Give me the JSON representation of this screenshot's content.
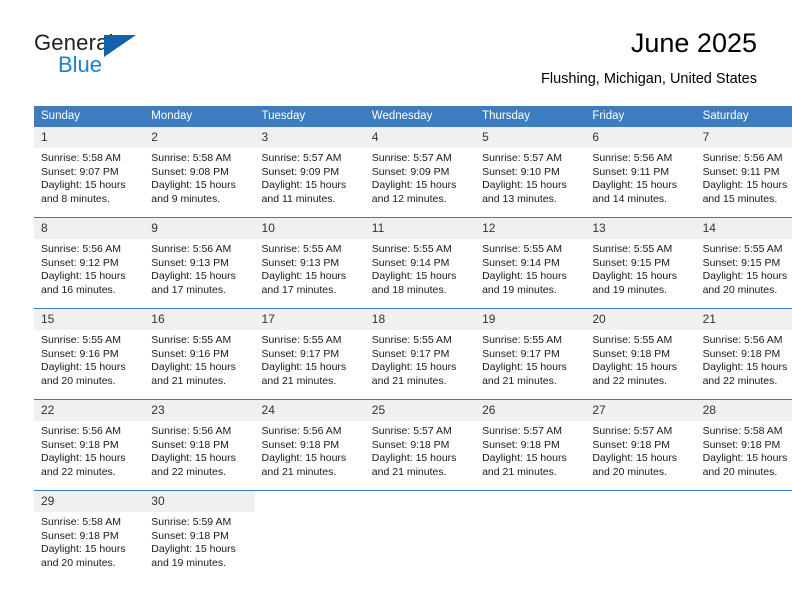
{
  "logo": {
    "word_top": "General",
    "word_bottom": "Blue",
    "triangle_color": "#1161ac",
    "blue_color": "#1b7fd4"
  },
  "header": {
    "title": "June 2025",
    "subtitle": "Flushing, Michigan, United States"
  },
  "theme": {
    "header_blue": "#3b7dbf",
    "daynum_background": "#f0f0f0"
  },
  "calendar": {
    "weekday_headers": [
      "Sunday",
      "Monday",
      "Tuesday",
      "Wednesday",
      "Thursday",
      "Friday",
      "Saturday"
    ],
    "weeks": [
      [
        {
          "day": "1",
          "sunrise": "Sunrise: 5:58 AM",
          "sunset": "Sunset: 9:07 PM",
          "daylight": "Daylight: 15 hours and 8 minutes."
        },
        {
          "day": "2",
          "sunrise": "Sunrise: 5:58 AM",
          "sunset": "Sunset: 9:08 PM",
          "daylight": "Daylight: 15 hours and 9 minutes."
        },
        {
          "day": "3",
          "sunrise": "Sunrise: 5:57 AM",
          "sunset": "Sunset: 9:09 PM",
          "daylight": "Daylight: 15 hours and 11 minutes."
        },
        {
          "day": "4",
          "sunrise": "Sunrise: 5:57 AM",
          "sunset": "Sunset: 9:09 PM",
          "daylight": "Daylight: 15 hours and 12 minutes."
        },
        {
          "day": "5",
          "sunrise": "Sunrise: 5:57 AM",
          "sunset": "Sunset: 9:10 PM",
          "daylight": "Daylight: 15 hours and 13 minutes."
        },
        {
          "day": "6",
          "sunrise": "Sunrise: 5:56 AM",
          "sunset": "Sunset: 9:11 PM",
          "daylight": "Daylight: 15 hours and 14 minutes."
        },
        {
          "day": "7",
          "sunrise": "Sunrise: 5:56 AM",
          "sunset": "Sunset: 9:11 PM",
          "daylight": "Daylight: 15 hours and 15 minutes."
        }
      ],
      [
        {
          "day": "8",
          "sunrise": "Sunrise: 5:56 AM",
          "sunset": "Sunset: 9:12 PM",
          "daylight": "Daylight: 15 hours and 16 minutes."
        },
        {
          "day": "9",
          "sunrise": "Sunrise: 5:56 AM",
          "sunset": "Sunset: 9:13 PM",
          "daylight": "Daylight: 15 hours and 17 minutes."
        },
        {
          "day": "10",
          "sunrise": "Sunrise: 5:55 AM",
          "sunset": "Sunset: 9:13 PM",
          "daylight": "Daylight: 15 hours and 17 minutes."
        },
        {
          "day": "11",
          "sunrise": "Sunrise: 5:55 AM",
          "sunset": "Sunset: 9:14 PM",
          "daylight": "Daylight: 15 hours and 18 minutes."
        },
        {
          "day": "12",
          "sunrise": "Sunrise: 5:55 AM",
          "sunset": "Sunset: 9:14 PM",
          "daylight": "Daylight: 15 hours and 19 minutes."
        },
        {
          "day": "13",
          "sunrise": "Sunrise: 5:55 AM",
          "sunset": "Sunset: 9:15 PM",
          "daylight": "Daylight: 15 hours and 19 minutes."
        },
        {
          "day": "14",
          "sunrise": "Sunrise: 5:55 AM",
          "sunset": "Sunset: 9:15 PM",
          "daylight": "Daylight: 15 hours and 20 minutes."
        }
      ],
      [
        {
          "day": "15",
          "sunrise": "Sunrise: 5:55 AM",
          "sunset": "Sunset: 9:16 PM",
          "daylight": "Daylight: 15 hours and 20 minutes."
        },
        {
          "day": "16",
          "sunrise": "Sunrise: 5:55 AM",
          "sunset": "Sunset: 9:16 PM",
          "daylight": "Daylight: 15 hours and 21 minutes."
        },
        {
          "day": "17",
          "sunrise": "Sunrise: 5:55 AM",
          "sunset": "Sunset: 9:17 PM",
          "daylight": "Daylight: 15 hours and 21 minutes."
        },
        {
          "day": "18",
          "sunrise": "Sunrise: 5:55 AM",
          "sunset": "Sunset: 9:17 PM",
          "daylight": "Daylight: 15 hours and 21 minutes."
        },
        {
          "day": "19",
          "sunrise": "Sunrise: 5:55 AM",
          "sunset": "Sunset: 9:17 PM",
          "daylight": "Daylight: 15 hours and 21 minutes."
        },
        {
          "day": "20",
          "sunrise": "Sunrise: 5:55 AM",
          "sunset": "Sunset: 9:18 PM",
          "daylight": "Daylight: 15 hours and 22 minutes."
        },
        {
          "day": "21",
          "sunrise": "Sunrise: 5:56 AM",
          "sunset": "Sunset: 9:18 PM",
          "daylight": "Daylight: 15 hours and 22 minutes."
        }
      ],
      [
        {
          "day": "22",
          "sunrise": "Sunrise: 5:56 AM",
          "sunset": "Sunset: 9:18 PM",
          "daylight": "Daylight: 15 hours and 22 minutes."
        },
        {
          "day": "23",
          "sunrise": "Sunrise: 5:56 AM",
          "sunset": "Sunset: 9:18 PM",
          "daylight": "Daylight: 15 hours and 22 minutes."
        },
        {
          "day": "24",
          "sunrise": "Sunrise: 5:56 AM",
          "sunset": "Sunset: 9:18 PM",
          "daylight": "Daylight: 15 hours and 21 minutes."
        },
        {
          "day": "25",
          "sunrise": "Sunrise: 5:57 AM",
          "sunset": "Sunset: 9:18 PM",
          "daylight": "Daylight: 15 hours and 21 minutes."
        },
        {
          "day": "26",
          "sunrise": "Sunrise: 5:57 AM",
          "sunset": "Sunset: 9:18 PM",
          "daylight": "Daylight: 15 hours and 21 minutes."
        },
        {
          "day": "27",
          "sunrise": "Sunrise: 5:57 AM",
          "sunset": "Sunset: 9:18 PM",
          "daylight": "Daylight: 15 hours and 20 minutes."
        },
        {
          "day": "28",
          "sunrise": "Sunrise: 5:58 AM",
          "sunset": "Sunset: 9:18 PM",
          "daylight": "Daylight: 15 hours and 20 minutes."
        }
      ],
      [
        {
          "day": "29",
          "sunrise": "Sunrise: 5:58 AM",
          "sunset": "Sunset: 9:18 PM",
          "daylight": "Daylight: 15 hours and 20 minutes."
        },
        {
          "day": "30",
          "sunrise": "Sunrise: 5:59 AM",
          "sunset": "Sunset: 9:18 PM",
          "daylight": "Daylight: 15 hours and 19 minutes."
        },
        {
          "day": "",
          "sunrise": "",
          "sunset": "",
          "daylight": ""
        },
        {
          "day": "",
          "sunrise": "",
          "sunset": "",
          "daylight": ""
        },
        {
          "day": "",
          "sunrise": "",
          "sunset": "",
          "daylight": ""
        },
        {
          "day": "",
          "sunrise": "",
          "sunset": "",
          "daylight": ""
        },
        {
          "day": "",
          "sunrise": "",
          "sunset": "",
          "daylight": ""
        }
      ]
    ]
  }
}
